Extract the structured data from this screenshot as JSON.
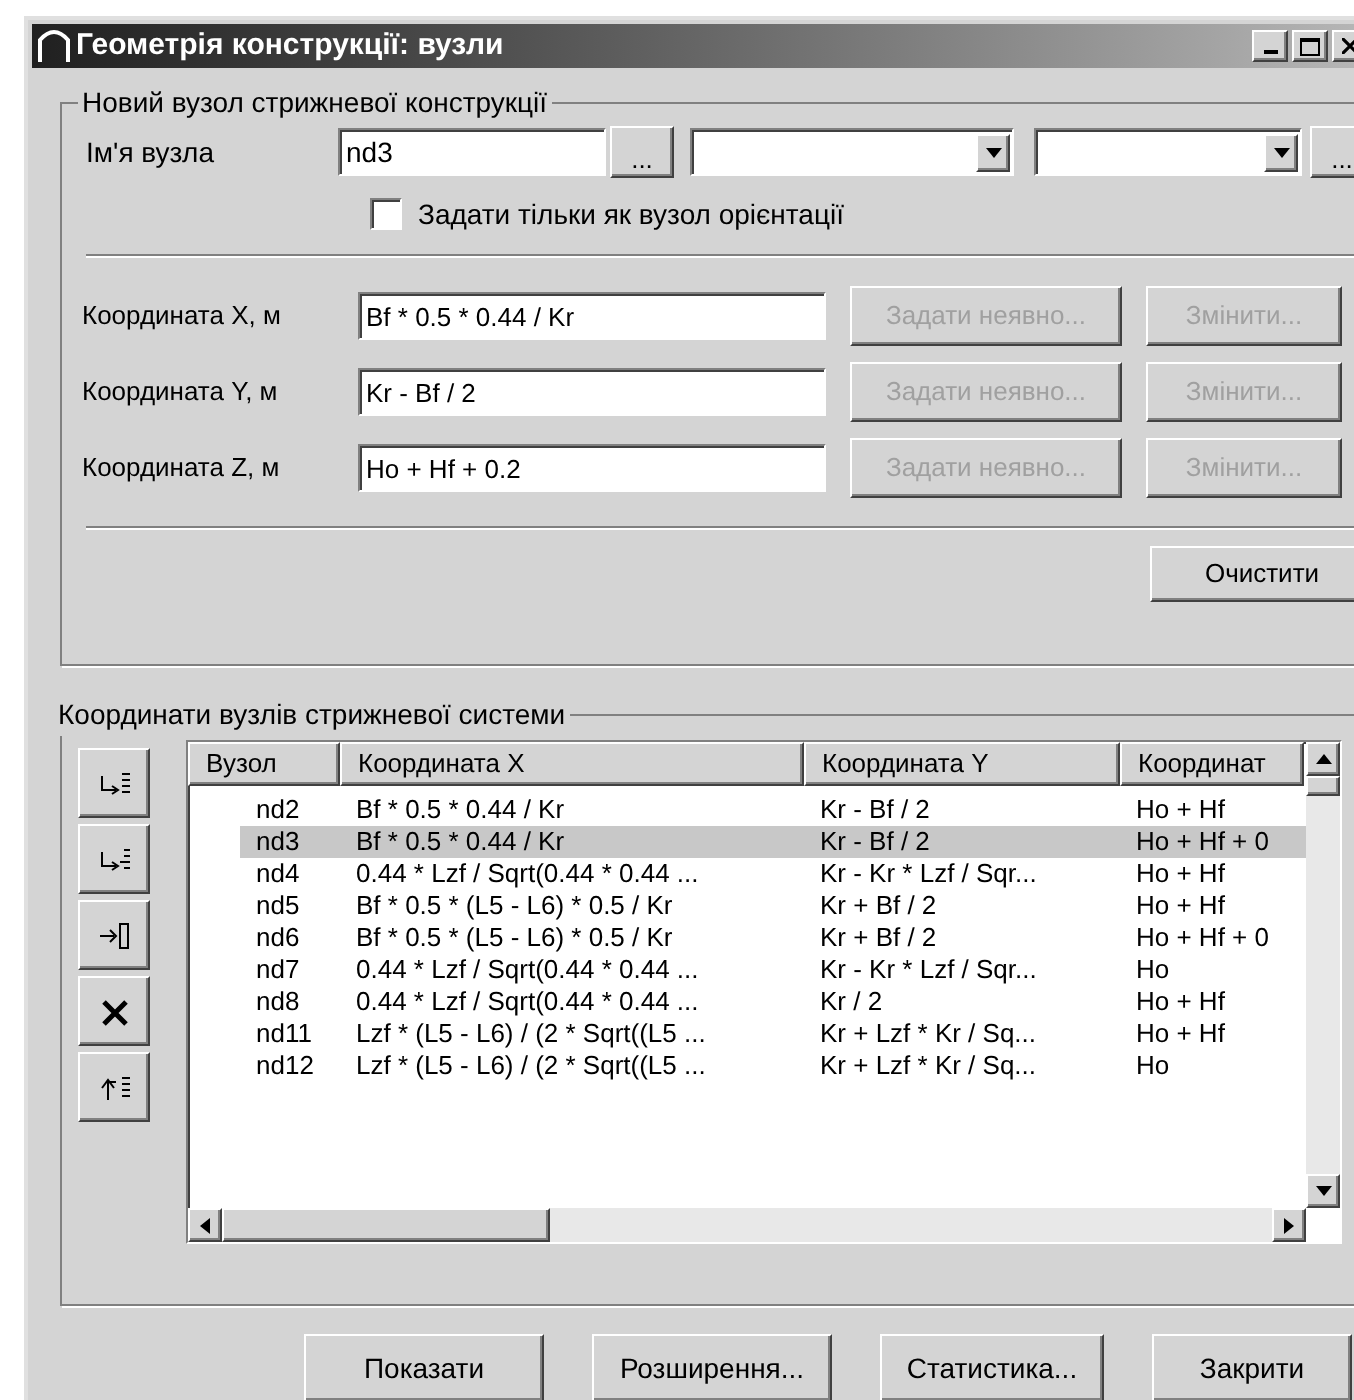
{
  "window": {
    "title": "Геометрія конструкції: вузли"
  },
  "new_node": {
    "title": "Новий вузол стрижневої конструкції",
    "name_label": "Ім'я вузла",
    "name_value": "nd3",
    "browse_button": "...",
    "browse_button_2": "...",
    "orientation_checkbox": {
      "label": "Задати тільки як вузол орієнтації",
      "checked": false
    },
    "coordinates": [
      {
        "label": "Координата X, м",
        "value": "Bf * 0.5 * 0.44 / Kr",
        "implicit_button": {
          "label": "Задати неявно...",
          "disabled": true
        },
        "edit_button": {
          "label": "Змінити...",
          "disabled": true
        }
      },
      {
        "label": "Координата Y, м",
        "value": "Kr - Bf / 2",
        "implicit_button": {
          "label": "Задати неявно...",
          "disabled": true
        },
        "edit_button": {
          "label": "Змінити...",
          "disabled": true
        }
      },
      {
        "label": "Координата Z, м",
        "value": "Ho + Hf + 0.2",
        "implicit_button": {
          "label": "Задати неявно...",
          "disabled": true
        },
        "edit_button": {
          "label": "Змінити...",
          "disabled": true
        }
      }
    ],
    "clear_button": "Очистити"
  },
  "nodes": {
    "title": "Координати вузлів стрижневої системи",
    "table": {
      "columns": [
        "Вузол",
        "Координата X",
        "Координата Y",
        "Координат"
      ],
      "rows": [
        {
          "cells": [
            "nd2",
            "Bf * 0.5 * 0.44 / Kr",
            "Kr - Bf / 2",
            "Ho + Hf"
          ],
          "selected": false
        },
        {
          "cells": [
            "nd3",
            "Bf * 0.5 * 0.44 / Kr",
            "Kr - Bf / 2",
            "Ho + Hf + 0"
          ],
          "selected": true
        },
        {
          "cells": [
            "nd4",
            "0.44 * Lzf / Sqrt(0.44 * 0.44 ...",
            "Kr - Kr * Lzf / Sqr...",
            "Ho + Hf"
          ],
          "selected": false
        },
        {
          "cells": [
            "nd5",
            "Bf * 0.5 * (L5 - L6) * 0.5 / Kr",
            "Kr + Bf / 2",
            "Ho + Hf"
          ],
          "selected": false
        },
        {
          "cells": [
            "nd6",
            "Bf * 0.5 * (L5 - L6) * 0.5 / Kr",
            "Kr + Bf / 2",
            "Ho + Hf + 0"
          ],
          "selected": false
        },
        {
          "cells": [
            "nd7",
            "0.44 * Lzf / Sqrt(0.44 * 0.44 ...",
            "Kr - Kr * Lzf / Sqr...",
            "Ho"
          ],
          "selected": false
        },
        {
          "cells": [
            "nd8",
            "0.44 * Lzf / Sqrt(0.44 * 0.44 ...",
            "Kr / 2",
            "Ho + Hf"
          ],
          "selected": false
        },
        {
          "cells": [
            "nd11",
            "Lzf * (L5 - L6) / (2 * Sqrt((L5 ...",
            "Kr + Lzf * Kr / Sq...",
            "Ho + Hf"
          ],
          "selected": false
        },
        {
          "cells": [
            "nd12",
            "Lzf * (L5 - L6) / (2 * Sqrt((L5 ...",
            "Kr + Lzf * Kr / Sq...",
            "Ho"
          ],
          "selected": false
        }
      ]
    }
  },
  "buttons": [
    "Показати",
    "Розширення...",
    "Статистика...",
    "Закрити"
  ]
}
